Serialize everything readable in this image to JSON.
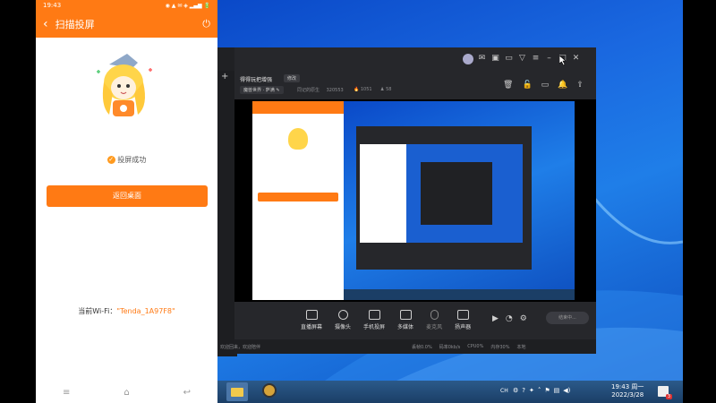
{
  "phone": {
    "status": {
      "time": "19:43",
      "icons": "◉ ▲ ✉ ◈ ▂▄▆ 🔋"
    },
    "header": {
      "back_icon": "chevron-left-icon",
      "title": "扫描投屏",
      "power_icon": "power-icon"
    },
    "success_text": "投屏成功",
    "return_button": "返回桌面",
    "wifi_label": "当前Wi-Fi：",
    "wifi_name": "\"Tenda_1A97F8\"",
    "nav": {
      "menu_icon": "menu-icon",
      "home_icon": "home-icon",
      "back_icon": "back-icon"
    }
  },
  "app": {
    "title": "得得玩把增强",
    "edit_tag": "修改",
    "game_tag": "魔兽世界 · 萨满",
    "stat1_label": "同记的原生",
    "stat1_value": "320553",
    "stat2_value": "1051",
    "stat3_value": "58",
    "toolbar": [
      {
        "label": "直播屏幕",
        "icon": "screen-icon"
      },
      {
        "label": "摄像头",
        "icon": "camera-icon"
      },
      {
        "label": "手机投屏",
        "icon": "phone-cast-icon"
      },
      {
        "label": "多媒体",
        "icon": "media-icon"
      },
      {
        "label": "麦克风",
        "icon": "mic-icon"
      },
      {
        "label": "扬声器",
        "icon": "speaker-icon"
      }
    ],
    "live_button": "结束中...",
    "footer_left": "欢迎回来，欢迎陪伴",
    "footer_stats": [
      "丢帧0.0%",
      "码率0kb/s",
      "CPU0%",
      "内存30%",
      "本地"
    ]
  },
  "taskbar": {
    "time": "19:43 周一",
    "date": "2022/3/28",
    "tray_text": "CH",
    "notify_count": "3"
  }
}
